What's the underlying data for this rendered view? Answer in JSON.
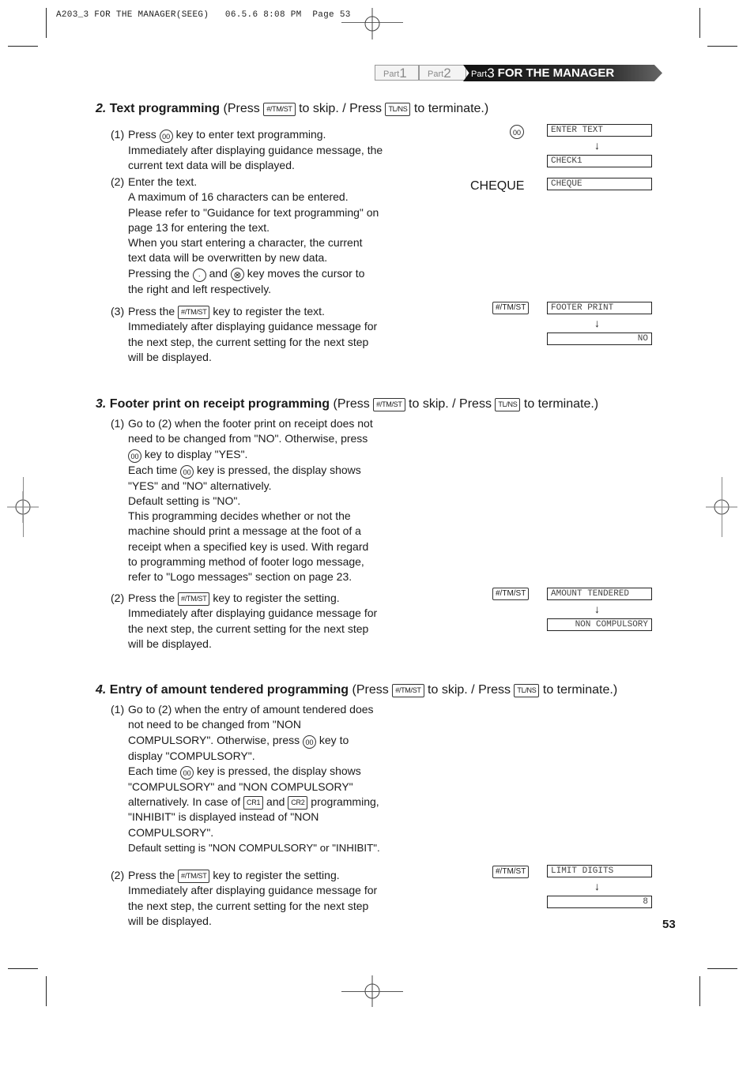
{
  "print_header": "A203_3 FOR THE MANAGER(SEEG)   06.5.6 8:08 PM  Page 53",
  "part_tabs": [
    {
      "prefix": "Part",
      "number": "1"
    },
    {
      "prefix": "Part",
      "number": "2"
    },
    {
      "prefix": "Part",
      "number": "3",
      "title": "FOR THE MANAGER"
    }
  ],
  "keys": {
    "skip": "#/TM/ST",
    "terminate": "TL/NS",
    "double_zero": "00",
    "point": "·",
    "multiply": "⊗",
    "cr1": "CR1",
    "cr2": "CR2"
  },
  "sections": [
    {
      "number": "2.",
      "title": "Text programming",
      "press_label": "(Press",
      "skip_label": "to skip. / Press",
      "terminate_label": "to terminate.)",
      "steps": [
        {
          "num": "(1)",
          "lines": [
            "Press",
            "key to enter text programming.",
            "Immediately after displaying guidance message, the",
            "current text data will be displayed."
          ]
        },
        {
          "num": "(2)",
          "lines": [
            "Enter the text.",
            "A maximum of 16 characters can be entered.",
            "Please refer to \"Guidance for text programming\" on",
            "page 13 for entering the text.",
            "When you start entering a character, the current",
            "text data will be overwritten by new data.",
            "Pressing the",
            "and",
            "key moves the cursor to",
            "the right and left respectively."
          ]
        },
        {
          "num": "(3)",
          "lines": [
            "Press the",
            "key to register the text.",
            "Immediately after displaying guidance message for",
            "the next step, the current setting for the next step",
            "will be displayed."
          ]
        }
      ],
      "operations": [
        {
          "key": "00",
          "displays": [
            "ENTER TEXT",
            "CHECK1"
          ]
        },
        {
          "input": "CHEQUE",
          "displays": [
            "CHEQUE"
          ]
        },
        {
          "key": "#/TM/ST",
          "displays": [
            "FOOTER PRINT",
            "NO"
          ]
        }
      ]
    },
    {
      "number": "3.",
      "title": "Footer print on receipt programming",
      "press_label": "(Press",
      "skip_label": "to skip. / Press",
      "terminate_label": "to terminate.)",
      "steps": [
        {
          "num": "(1)",
          "lines": [
            "Go to (2) when the footer print on receipt does not",
            "need to be changed from \"NO\".  Otherwise, press",
            "key to display \"YES\".",
            "Each time",
            "key is pressed, the display shows",
            "\"YES\" and \"NO\" alternatively.",
            "Default setting is \"NO\".",
            "This programming decides whether or not the",
            "machine should print a message at the foot of a",
            "receipt when a specified key is used.  With regard",
            "to programming method of footer logo message,",
            "refer to \"Logo messages\" section on page 23."
          ]
        },
        {
          "num": "(2)",
          "lines": [
            "Press the",
            "key to register the setting.",
            "Immediately after displaying guidance message for",
            "the next step, the current setting for the next step",
            "will be displayed."
          ]
        }
      ],
      "operations": [
        {
          "key": "#/TM/ST",
          "displays": [
            "AMOUNT TENDERED",
            "NON COMPULSORY"
          ]
        }
      ]
    },
    {
      "number": "4.",
      "title": "Entry of amount tendered programming",
      "press_label": "(Press",
      "skip_label": "to skip. / Press",
      "terminate_label": "to terminate.)",
      "steps": [
        {
          "num": "(1)",
          "lines": [
            "Go to (2) when the entry of amount tendered does",
            "not need to be changed from \"NON",
            "COMPULSORY\".  Otherwise, press",
            "key to",
            "display \"COMPULSORY\".",
            "Each time",
            "key is pressed, the display shows",
            "\"COMPULSORY\" and \"NON COMPULSORY\"",
            "alternatively.  In case of",
            "and",
            "programming,",
            "\"INHIBIT\" is displayed instead of \"NON",
            "COMPULSORY\".",
            "Default setting is \"NON COMPULSORY\" or \"INHIBIT\"."
          ]
        },
        {
          "num": "(2)",
          "lines": [
            "Press the",
            "key to register the setting.",
            "Immediately after displaying guidance message for",
            "the next step, the current setting for the next step",
            "will be displayed."
          ]
        }
      ],
      "operations": [
        {
          "key": "#/TM/ST",
          "displays": [
            "LIMIT DIGITS",
            "8"
          ]
        }
      ]
    }
  ],
  "arrow_glyph": "↓",
  "page_number": "53"
}
